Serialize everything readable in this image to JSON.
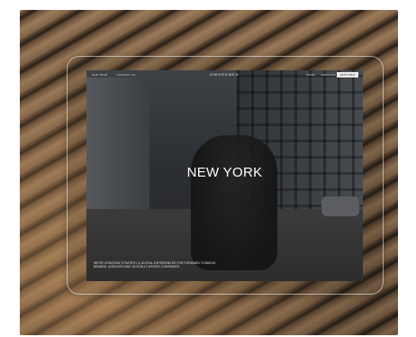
{
  "site": {
    "brand": "DWORKMEN",
    "nav_left": [
      "OUR TEAM",
      "CONTACT US"
    ],
    "nav_right": [
      "WORK",
      "SERVICES"
    ],
    "cta_label": "LET'S TALK"
  },
  "hero": {
    "title": "NEW YORK"
  },
  "caption": {
    "text": "WE'RE CREATING STRATEGY & DIGITAL EXPERIENCES FOR FORWARD-THINKING BRANDS, AGENCIES AND DIGITALLY-DRIVEN COMPANIES."
  }
}
